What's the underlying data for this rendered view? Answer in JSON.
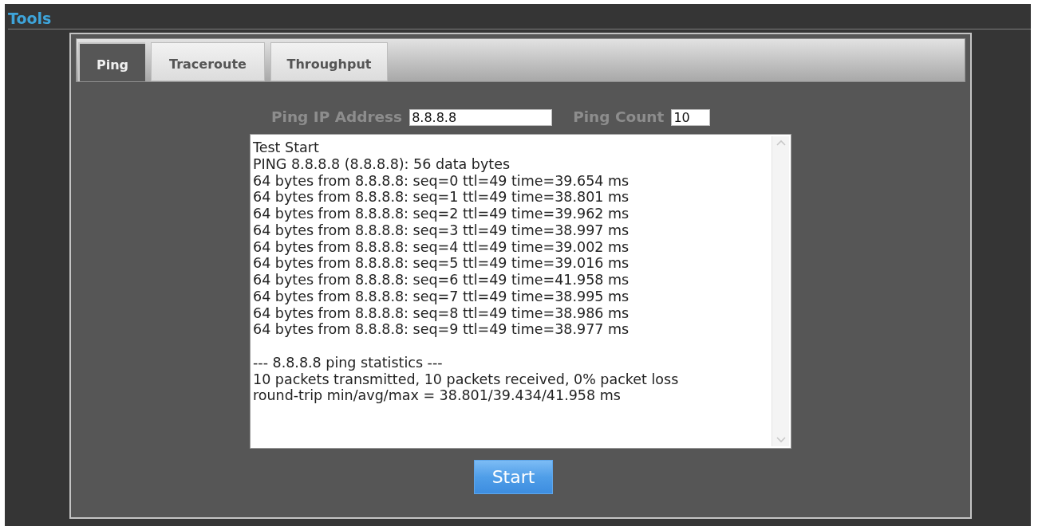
{
  "title": "Tools",
  "tabs": [
    {
      "label": "Ping",
      "selected": true
    },
    {
      "label": "Traceroute",
      "selected": false
    },
    {
      "label": "Throughput",
      "selected": false
    }
  ],
  "form": {
    "fields": [
      {
        "label": "Ping IP Address",
        "value": "8.8.8.8"
      },
      {
        "label": "Ping Count",
        "value": "10"
      }
    ]
  },
  "output": {
    "text": "Test Start\nPING 8.8.8.8 (8.8.8.8): 56 data bytes\n64 bytes from 8.8.8.8: seq=0 ttl=49 time=39.654 ms\n64 bytes from 8.8.8.8: seq=1 ttl=49 time=38.801 ms\n64 bytes from 8.8.8.8: seq=2 ttl=49 time=39.962 ms\n64 bytes from 8.8.8.8: seq=3 ttl=49 time=38.997 ms\n64 bytes from 8.8.8.8: seq=4 ttl=49 time=39.002 ms\n64 bytes from 8.8.8.8: seq=5 ttl=49 time=39.016 ms\n64 bytes from 8.8.8.8: seq=6 ttl=49 time=41.958 ms\n64 bytes from 8.8.8.8: seq=7 ttl=49 time=38.995 ms\n64 bytes from 8.8.8.8: seq=8 ttl=49 time=38.986 ms\n64 bytes from 8.8.8.8: seq=9 ttl=49 time=38.977 ms\n\n--- 8.8.8.8 ping statistics ---\n10 packets transmitted, 10 packets received, 0% packet loss\nround-trip min/avg/max = 38.801/39.434/41.958 ms"
  },
  "buttons": [
    {
      "label": "Start"
    }
  ]
}
